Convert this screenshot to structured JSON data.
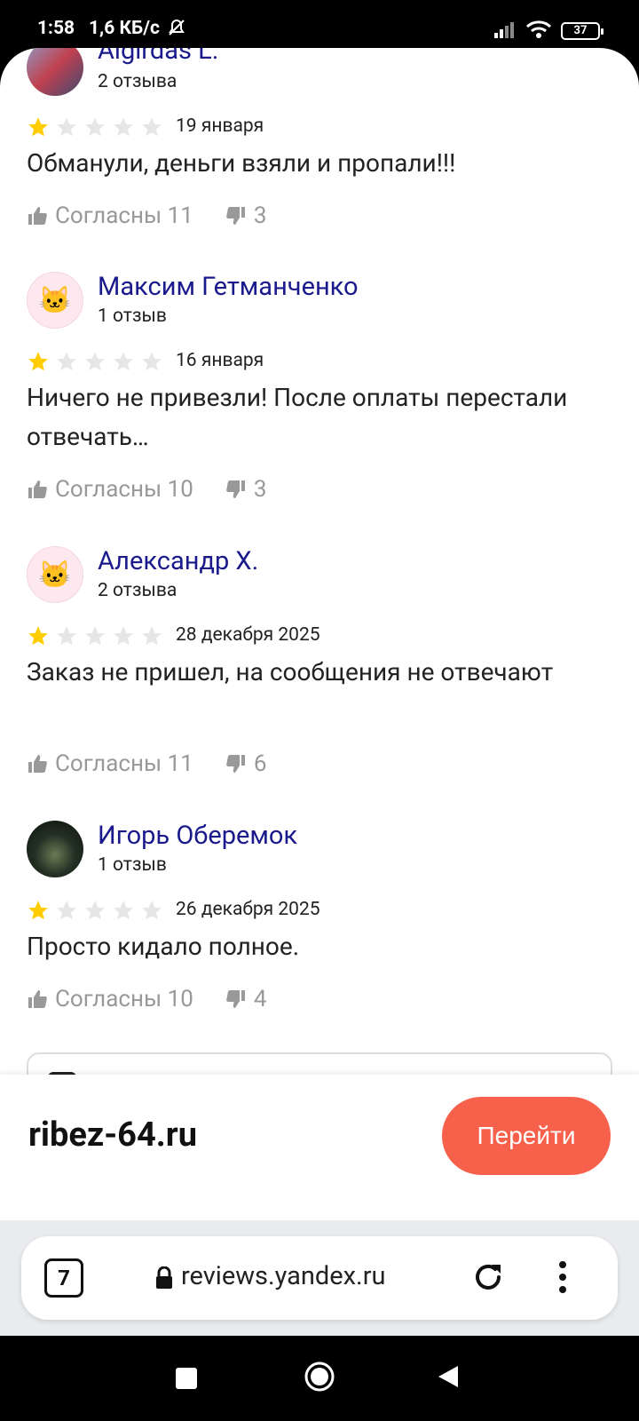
{
  "status_bar": {
    "time": "1:58",
    "network_speed": "1,6 КБ/с",
    "battery": "37"
  },
  "reviews": [
    {
      "author": "Algirdas L.",
      "count": "2 отзыва",
      "rating": 1,
      "date": "19 января",
      "text": "Обманули, деньги взяли и пропали!!!",
      "agree_label": "Согласны",
      "agree": "11",
      "disagree": "3",
      "avatar": "photo"
    },
    {
      "author": "Максим Гетманченко",
      "count": "1 отзыв",
      "rating": 1,
      "date": "16 января",
      "text": "Ничего не привезли! После оплаты перестали отвечать…",
      "agree_label": "Согласны",
      "agree": "10",
      "disagree": "3",
      "avatar": "cat-icon"
    },
    {
      "author": "Александр Х.",
      "count": "2 отзыва",
      "rating": 1,
      "date": "28 декабря 2025",
      "text": "Заказ не пришел, на сообщения не отвечают",
      "agree_label": "Согласны",
      "agree": "11",
      "disagree": "6",
      "avatar": "cat-icon"
    },
    {
      "author": "Игорь Оберемок",
      "count": "1 отзыв",
      "rating": 1,
      "date": "26 декабря 2025",
      "text": "Просто кидало полное.",
      "agree_label": "Согласны",
      "agree": "10",
      "disagree": "4",
      "avatar": "photo"
    }
  ],
  "site_bar": {
    "site": "ribez-64.ru",
    "button": "Перейти"
  },
  "browser": {
    "tab_count": "7",
    "url": "reviews.yandex.ru"
  },
  "colors": {
    "star_filled": "#FFCC00",
    "star_empty": "#E6E6E6",
    "author": "#1A1A8C",
    "button": "#F7604A"
  }
}
